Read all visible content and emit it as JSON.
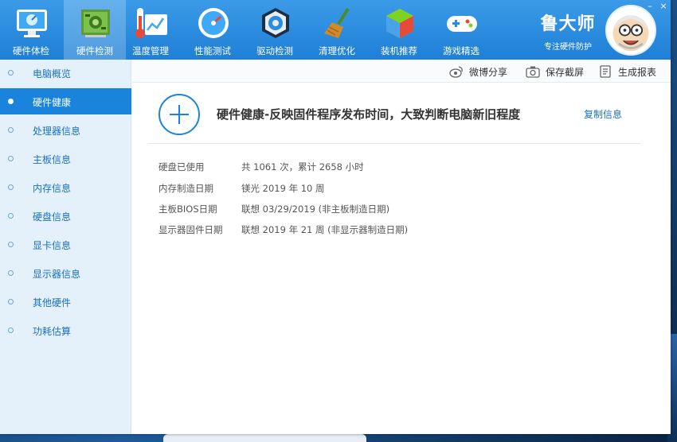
{
  "toolbar": {
    "items": [
      {
        "label": "硬件体检",
        "icon": "monitor-icon"
      },
      {
        "label": "硬件检测",
        "icon": "circuit-board-icon"
      },
      {
        "label": "温度管理",
        "icon": "thermometer-icon"
      },
      {
        "label": "性能测试",
        "icon": "speedometer-icon"
      },
      {
        "label": "驱动检测",
        "icon": "driver-gear-icon"
      },
      {
        "label": "清理优化",
        "icon": "broom-icon"
      },
      {
        "label": "装机推荐",
        "icon": "box-icon"
      },
      {
        "label": "游戏精选",
        "icon": "gamepad-icon"
      }
    ],
    "active_index": 1
  },
  "brand": {
    "name": "鲁大师",
    "slogan": "专注硬件防护"
  },
  "sidebar": {
    "items": [
      {
        "label": "电脑概览"
      },
      {
        "label": "硬件健康"
      },
      {
        "label": "处理器信息"
      },
      {
        "label": "主板信息"
      },
      {
        "label": "内存信息"
      },
      {
        "label": "硬盘信息"
      },
      {
        "label": "显卡信息"
      },
      {
        "label": "显示器信息"
      },
      {
        "label": "其他硬件"
      },
      {
        "label": "功耗估算"
      }
    ],
    "active_index": 1
  },
  "actions": {
    "share": "微博分享",
    "screenshot": "保存截屏",
    "report": "生成报表"
  },
  "content": {
    "headline": "硬件健康-反映固件程序发布时间，大致判断电脑新旧程度",
    "copy_label": "复制信息",
    "rows": [
      {
        "label": "硬盘已使用",
        "value": "共 1061 次，累计 2658 小时"
      },
      {
        "label": "内存制造日期",
        "value": "镁光 2019 年 10 周"
      },
      {
        "label": "主板BIOS日期",
        "value": "联想 03/29/2019 (非主板制造日期)"
      },
      {
        "label": "显示器固件日期",
        "value": "联想 2019 年 21 周 (非显示器制造日期)"
      }
    ]
  },
  "colors": {
    "header": "#2a8be0",
    "accent": "#1a84dc",
    "sidebar_bg": "#e4f1fb",
    "link": "#1a6fc2"
  }
}
